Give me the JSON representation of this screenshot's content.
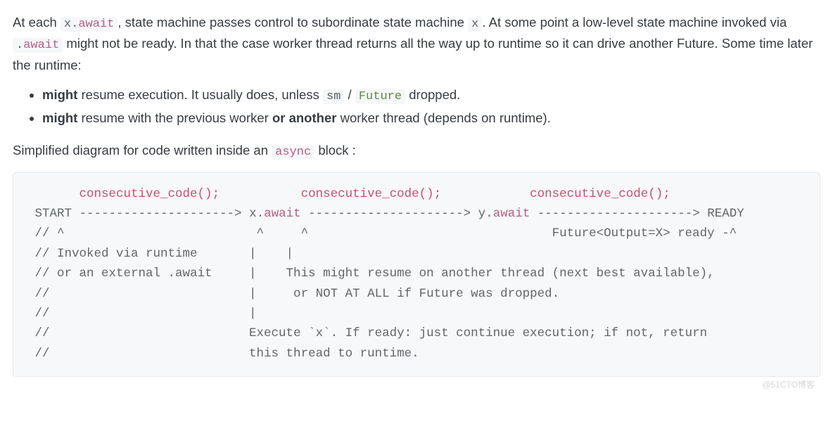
{
  "para1": {
    "t1": "At each ",
    "code1_x": "x",
    "code1_dot": ".",
    "code1_await": "await",
    "t2": ", state machine passes control to subordinate state machine ",
    "code2": "x",
    "t3": ". At some point a low-level state machine invoked via ",
    "code3_dot": ".",
    "code3_await": "await",
    "t4": " might not be ready. In that the case worker thread returns all the way up to runtime so it can drive another Future. Some time later the runtime:"
  },
  "bullets": {
    "b1": {
      "strong": "might",
      "t1": " resume execution. It usually does, unless ",
      "code1": "sm",
      "t2": " / ",
      "code2": "Future",
      "t3": " dropped."
    },
    "b2": {
      "strong": "might",
      "t1": " resume with the previous worker ",
      "strong2": "or another",
      "t2": " worker thread (depends on runtime)."
    }
  },
  "para2": {
    "t1": "Simplified diagram for code written inside an ",
    "code1": "async",
    "t2": " block :"
  },
  "code": {
    "l1a": "       ",
    "l1b": "consecutive_code();",
    "l1c": "           ",
    "l1d": "consecutive_code();",
    "l1e": "            ",
    "l1f": "consecutive_code();",
    "l2a": " START",
    "l2b": " --------------------->",
    "l2c": " x",
    "l2d": ".",
    "l2e": "await",
    "l2f": " --------------------->",
    "l2g": " y",
    "l2h": ".",
    "l2i": "await",
    "l2j": " --------------------->",
    "l2k": " READY",
    "l3": " // ^                          ^     ^                                 Future<Output=X> ready -^",
    "l4": " // Invoked via runtime       |    |",
    "l5": " // or an external .await     |    This might resume on another thread (next best available),",
    "l6": " //                           |     or NOT AT ALL if Future was dropped.",
    "l7": " //                           |",
    "l8": " //                           Execute `x`. If ready: just continue execution; if not, return",
    "l9": " //                           this thread to runtime."
  },
  "watermark": "@51CTO博客"
}
